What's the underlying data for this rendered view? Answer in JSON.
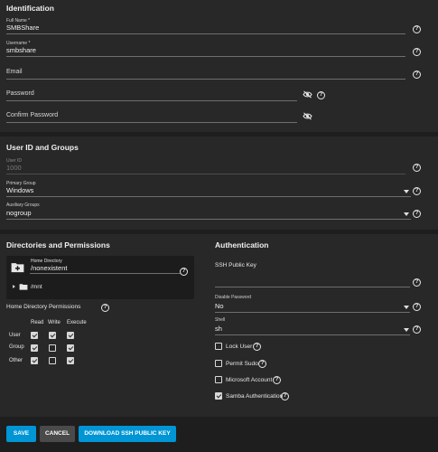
{
  "identification": {
    "title": "Identification",
    "full_name_label": "Full Name *",
    "full_name_value": "SMBShare",
    "username_label": "Username *",
    "username_value": "smbshare",
    "email_label": "Email",
    "password_label": "Password",
    "confirm_password_label": "Confirm Password"
  },
  "user_id_groups": {
    "title": "User ID and Groups",
    "user_id_label": "User ID",
    "user_id_value": "1000",
    "primary_group_label": "Primary Group",
    "primary_group_value": "Windows",
    "aux_groups_label": "Auxiliary Groups",
    "aux_groups_value": "nogroup"
  },
  "directories": {
    "title": "Directories and Permissions",
    "home_dir_label": "Home Directory",
    "home_dir_value": "/nonexistent",
    "tree_item": "/mnt",
    "permissions_label": "Home Directory Permissions",
    "columns": [
      "Read",
      "Write",
      "Execute"
    ],
    "rows": [
      {
        "name": "User",
        "read": true,
        "write": true,
        "execute": true
      },
      {
        "name": "Group",
        "read": true,
        "write": false,
        "execute": true
      },
      {
        "name": "Other",
        "read": true,
        "write": false,
        "execute": true
      }
    ]
  },
  "authentication": {
    "title": "Authentication",
    "ssh_key_label": "SSH Public Key",
    "disable_password_label": "Disable Password",
    "disable_password_value": "No",
    "shell_label": "Shell",
    "shell_value": "sh",
    "lock_user": "Lock User",
    "permit_sudo": "Permit Sudo",
    "microsoft_account": "Microsoft Account",
    "samba_auth": "Samba Authentication",
    "lock_user_checked": false,
    "permit_sudo_checked": false,
    "microsoft_account_checked": false,
    "samba_auth_checked": true
  },
  "buttons": {
    "save": "SAVE",
    "cancel": "CANCEL",
    "download": "DOWNLOAD SSH PUBLIC KEY"
  },
  "colors": {
    "primary_button": "#0095d5",
    "panel_bg": "#282828",
    "page_bg": "#1e1e1e"
  }
}
